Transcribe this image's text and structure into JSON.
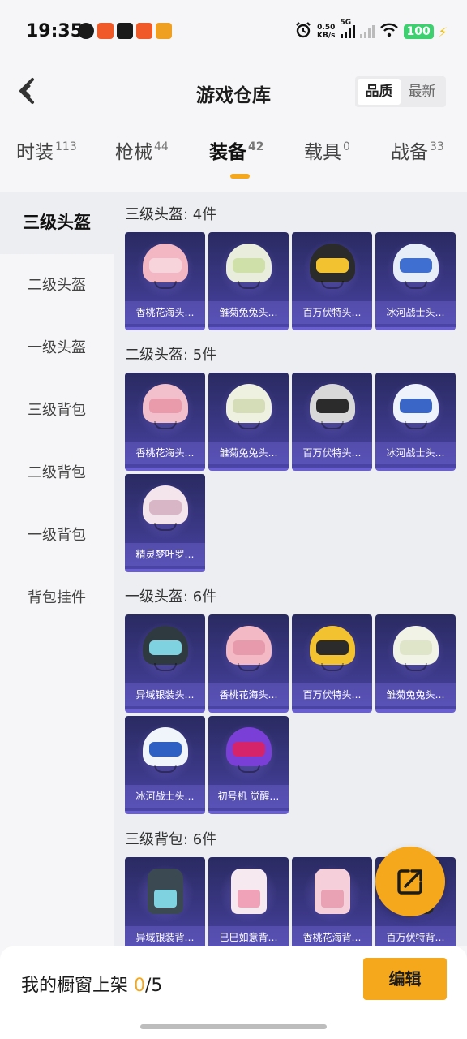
{
  "status_bar": {
    "time": "19:35",
    "net_speed_value": "0.50",
    "net_speed_unit": "KB/s",
    "network": "5G",
    "battery": "100",
    "notif_colors": [
      "#1a1a1a",
      "#f05a28",
      "#1a1a1a",
      "#f05a28",
      "#f0a020"
    ]
  },
  "header": {
    "title": "游戏仓库",
    "sort_options": [
      "品质",
      "最新"
    ]
  },
  "tabs": [
    {
      "label": "时装",
      "count": "113"
    },
    {
      "label": "枪械",
      "count": "44"
    },
    {
      "label": "装备",
      "count": "42"
    },
    {
      "label": "载具",
      "count": "0"
    },
    {
      "label": "战备",
      "count": "33"
    }
  ],
  "sidebar": {
    "items": [
      "三级头盔",
      "二级头盔",
      "一级头盔",
      "三级背包",
      "二级背包",
      "一级背包",
      "背包挂件"
    ]
  },
  "sections": [
    {
      "title": "三级头盔: 4件",
      "items": [
        {
          "name": "香桃花海头…",
          "kind": "helmet",
          "color": "#f3b7c4",
          "visor": "#f7d3dc"
        },
        {
          "name": "雏菊兔兔头…",
          "kind": "helmet",
          "color": "#e8eddc",
          "visor": "#cfe0a8"
        },
        {
          "name": "百万伏特头…",
          "kind": "helmet",
          "color": "#2b2b2b",
          "visor": "#f2c230"
        },
        {
          "name": "冰河战士头…",
          "kind": "helmet",
          "color": "#e8eef8",
          "visor": "#3f6fd1"
        }
      ]
    },
    {
      "title": "二级头盔: 5件",
      "items": [
        {
          "name": "香桃花海头…",
          "kind": "helmet",
          "color": "#f2c0cc",
          "visor": "#e99aab"
        },
        {
          "name": "雏菊兔兔头…",
          "kind": "helmet",
          "color": "#eef1e0",
          "visor": "#d4dcb8"
        },
        {
          "name": "百万伏特头…",
          "kind": "helmet",
          "color": "#d8d8d8",
          "visor": "#2b2b2b"
        },
        {
          "name": "冰河战士头…",
          "kind": "helmet",
          "color": "#eef2fa",
          "visor": "#3a66c8"
        },
        {
          "name": "精灵梦叶罗…",
          "kind": "helmet",
          "color": "#f4e4ec",
          "visor": "#d9b6c6"
        }
      ]
    },
    {
      "title": "一级头盔: 6件",
      "items": [
        {
          "name": "异域银装头…",
          "kind": "helmet",
          "color": "#2f3a40",
          "visor": "#7fd2e0"
        },
        {
          "name": "香桃花海头…",
          "kind": "helmet",
          "color": "#f3b9c5",
          "visor": "#e79aab"
        },
        {
          "name": "百万伏特头…",
          "kind": "helmet",
          "color": "#f2c230",
          "visor": "#2b2b2b"
        },
        {
          "name": "雏菊兔兔头…",
          "kind": "helmet",
          "color": "#f1f3e6",
          "visor": "#dfe5c8"
        },
        {
          "name": "冰河战士头…",
          "kind": "helmet",
          "color": "#f0f4fb",
          "visor": "#2e5fc2"
        },
        {
          "name": "初号机 觉醒…",
          "kind": "helmet",
          "color": "#7a3fd6",
          "visor": "#d6246a"
        }
      ]
    },
    {
      "title": "三级背包: 6件",
      "items": [
        {
          "name": "异域银装背…",
          "kind": "backpack",
          "color": "#3b4a52",
          "visor": "#7fd2e0"
        },
        {
          "name": "巳巳如意背…",
          "kind": "backpack",
          "color": "#f6e9ef",
          "visor": "#f0a3b8"
        },
        {
          "name": "香桃花海背…",
          "kind": "backpack",
          "color": "#f5d0da",
          "visor": "#e8a2b4"
        },
        {
          "name": "百万伏特背…",
          "kind": "backpack",
          "color": "#2b2b2b",
          "visor": "#f2c230"
        }
      ]
    }
  ],
  "bottom_bar": {
    "showcase_label": "我的橱窗上架",
    "showcase_used": "0",
    "showcase_total": "/5",
    "edit_label": "编辑"
  },
  "colors": {
    "accent": "#f6a81c",
    "card_top": "#2a2a62",
    "card_bottom": "#4a45a6"
  }
}
